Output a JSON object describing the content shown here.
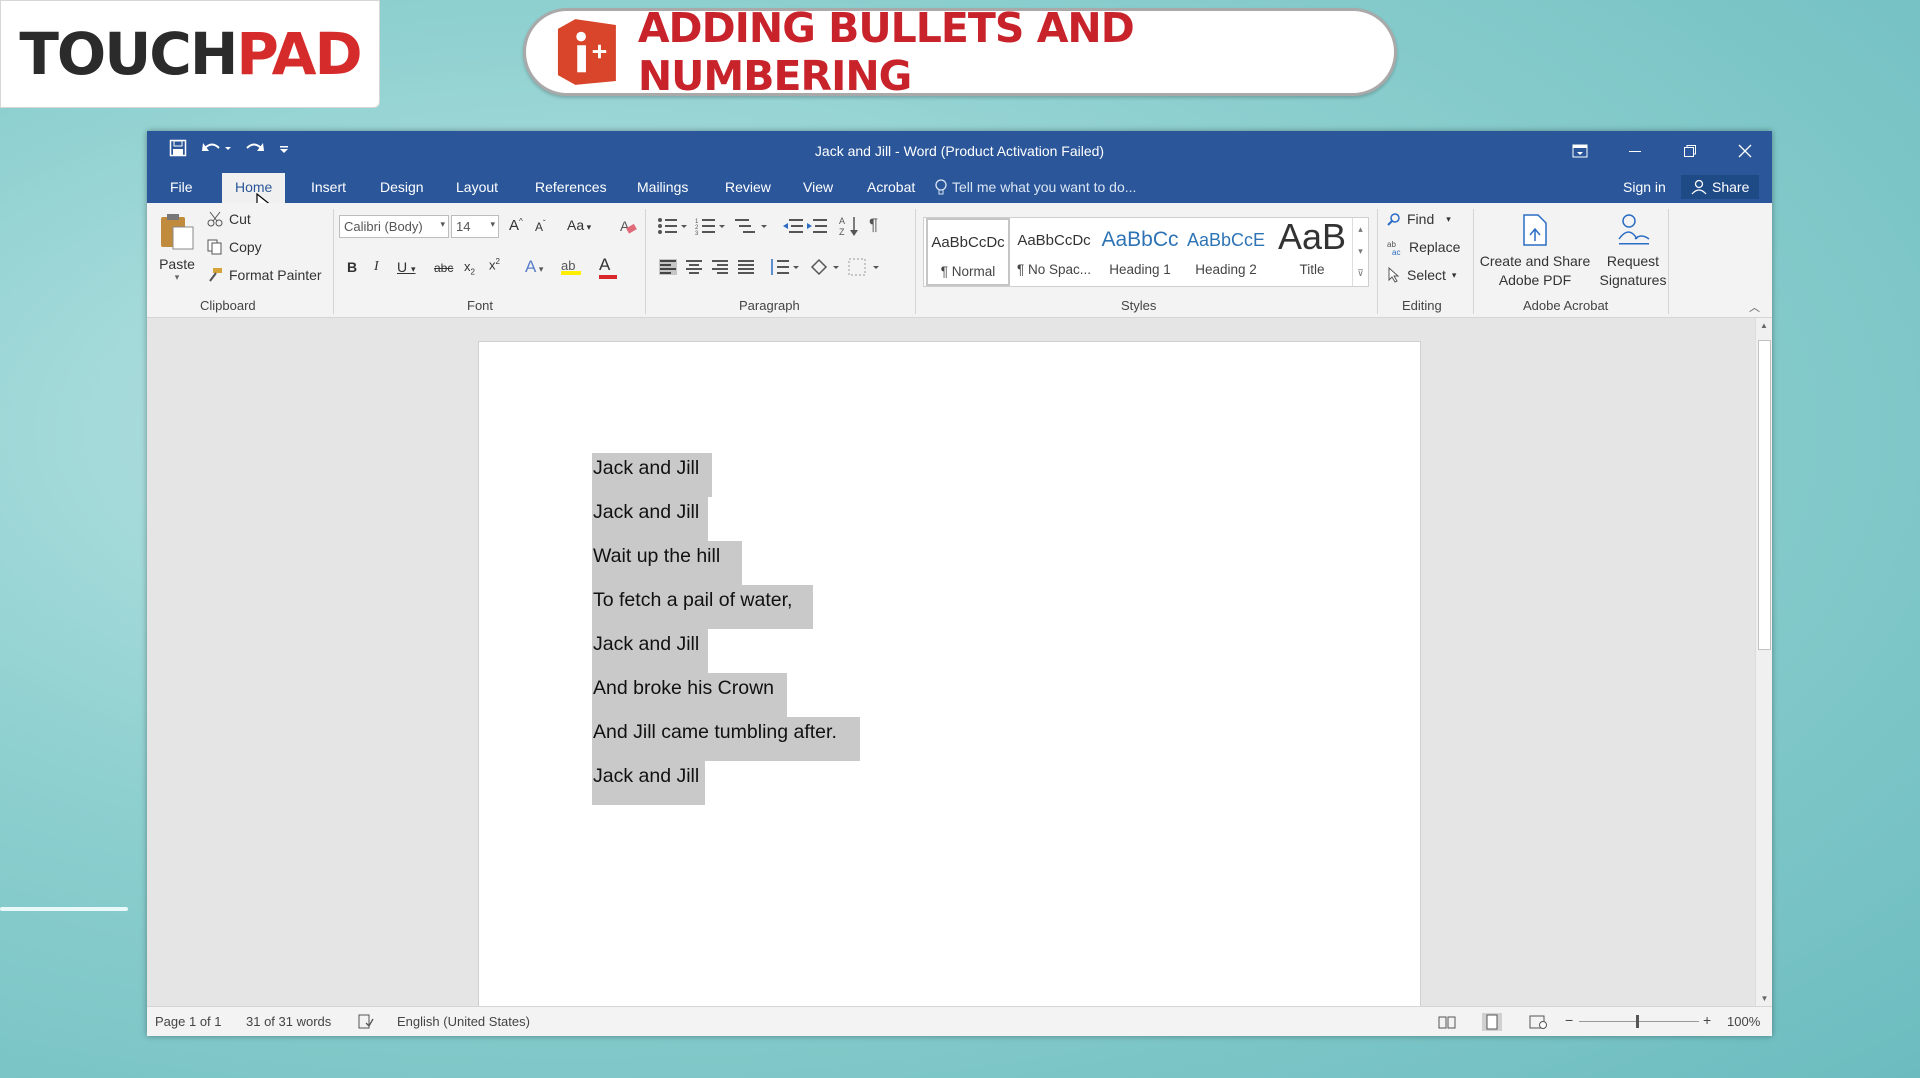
{
  "brand": {
    "logo_left": "TOUCH",
    "logo_right": "PAD",
    "lesson_title": "ADDING BULLETS AND NUMBERING"
  },
  "window": {
    "title": "Jack and Jill - Word (Product Activation Failed)"
  },
  "tabs": [
    "File",
    "Home",
    "Insert",
    "Design",
    "Layout",
    "References",
    "Mailings",
    "Review",
    "View",
    "Acrobat"
  ],
  "active_tab": "Home",
  "tell_me": "Tell me what you want to do...",
  "sign_in": "Sign in",
  "share": "Share",
  "clipboard": {
    "paste": "Paste",
    "cut": "Cut",
    "copy": "Copy",
    "format_painter": "Format Painter",
    "label": "Clipboard"
  },
  "font": {
    "name": "Calibri (Body)",
    "size": "14",
    "change_case": "Aa",
    "label": "Font"
  },
  "paragraph": {
    "label": "Paragraph"
  },
  "styles": {
    "items": [
      {
        "preview": "AaBbCcDc",
        "name": "¶ Normal"
      },
      {
        "preview": "AaBbCcDc",
        "name": "¶ No Spac..."
      },
      {
        "preview": "AaBbCc",
        "name": "Heading 1"
      },
      {
        "preview": "AaBbCcE",
        "name": "Heading 2"
      },
      {
        "preview": "AaB",
        "name": "Title"
      }
    ],
    "label": "Styles"
  },
  "editing": {
    "find": "Find",
    "replace": "Replace",
    "select": "Select",
    "label": "Editing"
  },
  "acrobat": {
    "create_line1": "Create and Share",
    "create_line2": "Adobe PDF",
    "request_line1": "Request",
    "request_line2": "Signatures",
    "label": "Adobe Acrobat"
  },
  "document": {
    "lines": [
      "Jack and Jill",
      "Jack and Jill",
      "Wait up the hill",
      "To fetch a pail of water,",
      "Jack and Jill",
      "And broke his Crown",
      "And Jill came tumbling after.",
      "Jack and Jill"
    ]
  },
  "statusbar": {
    "page": "Page 1 of 1",
    "words": "31 of 31 words",
    "language": "English (United States)",
    "zoom": "100%"
  },
  "colors": {
    "word_blue": "#2b579a",
    "brand_red": "#d62b2b",
    "selection": "#c9c9c9"
  },
  "icons": [
    "save-icon",
    "undo-icon",
    "redo-icon",
    "customize-icon",
    "ribbon-display-icon",
    "minimize-icon",
    "restore-icon",
    "close-icon",
    "lightbulb-icon",
    "person-icon",
    "paste-icon",
    "scissors-icon",
    "copy-icon",
    "paintbrush-icon",
    "bullets-icon",
    "numbering-icon",
    "multilevel-icon",
    "indent-icon",
    "sort-icon",
    "pilcrow-icon",
    "align-icons",
    "find-icon",
    "replace-icon",
    "select-icon",
    "pdf-icon",
    "signature-icon"
  ]
}
